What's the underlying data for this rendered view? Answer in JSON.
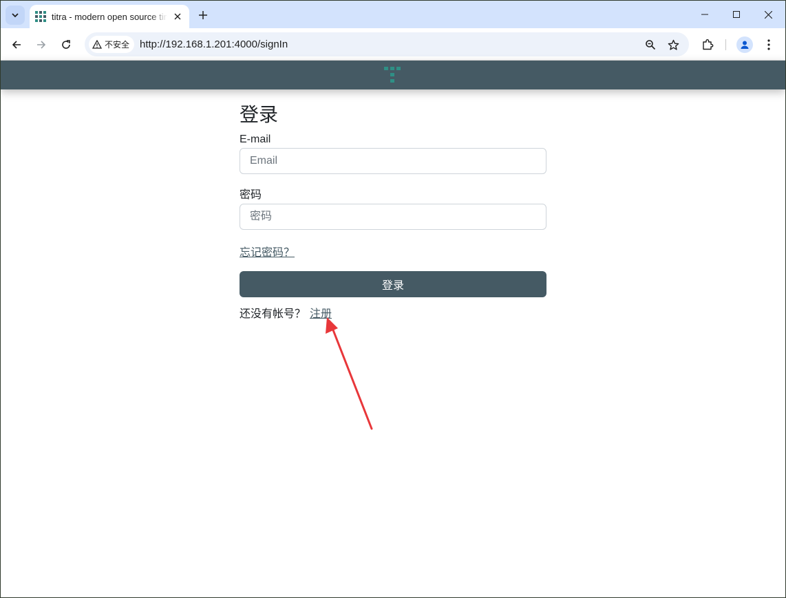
{
  "browser": {
    "tab_title": "titra - modern open source time tracking",
    "security_label": "不安全",
    "url": "http://192.168.1.201:4000/signIn"
  },
  "signin": {
    "title": "登录",
    "email_label": "E-mail",
    "email_placeholder": "Email",
    "password_label": "密码",
    "password_placeholder": "密码",
    "forgot_password": "忘记密码？",
    "submit_label": "登录",
    "no_account_text": "还没有帐号？",
    "register_link": "注册"
  },
  "colors": {
    "header": "#455a64",
    "accent": "#2f8f85",
    "annotation_arrow": "#e8373a"
  }
}
